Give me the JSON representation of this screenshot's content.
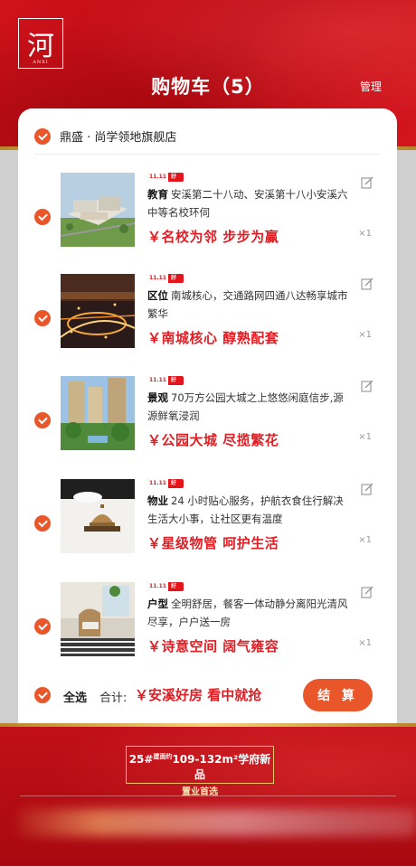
{
  "header": {
    "logo_glyph": "河",
    "logo_sub": "ANXI",
    "title": "购物车（5）",
    "manage_label": "管理"
  },
  "store": {
    "name": "鼎盛 · 尚学领地旗舰店"
  },
  "items": [
    {
      "badge_a": "11.11",
      "badge_b": "淘好房",
      "key": "教育",
      "text": "安溪第二十八动、安溪第十八小安溪六中等名校环伺",
      "slogan": "￥名校为邻 步步为赢",
      "qty": "×1",
      "image": "school-campus"
    },
    {
      "badge_a": "11.11",
      "badge_b": "淘好房",
      "key": "区位",
      "text": "南城核心，交通路网四通八达畅享城市繁华",
      "slogan": "￥南城核心 醇熟配套",
      "qty": "×1",
      "image": "city-night-interchange"
    },
    {
      "badge_a": "11.11",
      "badge_b": "淘好房",
      "key": "景观",
      "text": "70万方公园大城之上悠悠闲庭信步,源源鲜氧浸润",
      "slogan": "￥公园大城 尽揽繁花",
      "qty": "×1",
      "image": "garden-towers"
    },
    {
      "badge_a": "11.11",
      "badge_b": "淘好房",
      "key": "物业",
      "text": "24 小时贴心服务，护航衣食住行解决生活大小事，让社区更有温度",
      "slogan": "￥星级物管 呵护生活",
      "qty": "×1",
      "image": "service-bell"
    },
    {
      "badge_a": "11.11",
      "badge_b": "淘好房",
      "key": "户型",
      "text": "全明舒居，餐客一体动静分离阳光清风尽享，户户送一房",
      "slogan": "￥诗意空间 阔气雍容",
      "qty": "×1",
      "image": "balcony-chair"
    }
  ],
  "footer": {
    "select_all": "全选",
    "total_label": "合计:",
    "total_value": "￥安溪好房 看中就抢",
    "checkout": "结 算"
  },
  "promo": {
    "line1_a": "25#",
    "line1_sup": "建面约",
    "line1_b": "109-132m²学府新品",
    "line2": "置业首选"
  },
  "colors": {
    "brand_red": "#c20d16",
    "accent_orange": "#e8562a",
    "slogan_red": "#e01e24",
    "gold": "#f4d27a"
  }
}
